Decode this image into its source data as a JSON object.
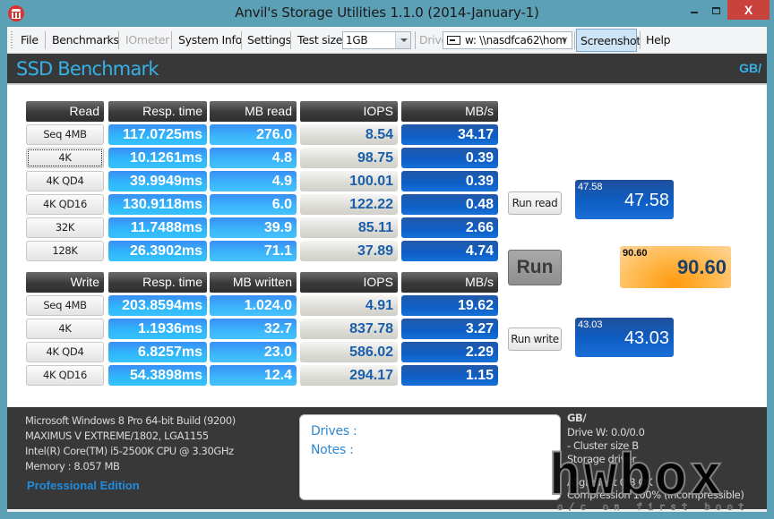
{
  "window": {
    "title": "Anvil's Storage Utilities 1.1.0 (2014-January-1)",
    "close_glyph": "X"
  },
  "toolbar": {
    "file": "File",
    "benchmarks": "Benchmarks",
    "iometer": "IOmeter",
    "system_info": "System Info",
    "settings": "Settings",
    "test_size_label": "Test size",
    "test_size_value": "1GB",
    "drive_label": "Drive",
    "drive_value": "w: \\\\nasdfca62\\hom",
    "drive_chevron": "∨",
    "screenshot": "Screenshot",
    "help": "Help"
  },
  "header": {
    "title": "SSD Benchmark",
    "unit_tag": "GB/"
  },
  "read_table": {
    "headers": [
      "Read",
      "Resp. time",
      "MB read",
      "IOPS",
      "MB/s"
    ],
    "rows": [
      {
        "test": "Seq 4MB",
        "resp": "117.0725ms",
        "mb": "276.0",
        "iops": "8.54",
        "mbs": "34.17"
      },
      {
        "test": "4K",
        "resp": "10.1261ms",
        "mb": "4.8",
        "iops": "98.75",
        "mbs": "0.39"
      },
      {
        "test": "4K QD4",
        "resp": "39.9949ms",
        "mb": "4.9",
        "iops": "100.01",
        "mbs": "0.39"
      },
      {
        "test": "4K QD16",
        "resp": "130.9118ms",
        "mb": "6.0",
        "iops": "122.22",
        "mbs": "0.48"
      },
      {
        "test": "32K",
        "resp": "11.7488ms",
        "mb": "39.9",
        "iops": "85.11",
        "mbs": "2.66"
      },
      {
        "test": "128K",
        "resp": "26.3902ms",
        "mb": "71.1",
        "iops": "37.89",
        "mbs": "4.74"
      }
    ]
  },
  "write_table": {
    "headers": [
      "Write",
      "Resp. time",
      "MB written",
      "IOPS",
      "MB/s"
    ],
    "rows": [
      {
        "test": "Seq 4MB",
        "resp": "203.8594ms",
        "mb": "1.024.0",
        "iops": "4.91",
        "mbs": "19.62"
      },
      {
        "test": "4K",
        "resp": "1.1936ms",
        "mb": "32.7",
        "iops": "837.78",
        "mbs": "3.27"
      },
      {
        "test": "4K QD4",
        "resp": "6.8257ms",
        "mb": "23.0",
        "iops": "586.02",
        "mbs": "2.29"
      },
      {
        "test": "4K QD16",
        "resp": "54.3898ms",
        "mb": "12.4",
        "iops": "294.17",
        "mbs": "1.15"
      }
    ]
  },
  "controls": {
    "run_read": "Run read",
    "run": "Run",
    "run_write": "Run write"
  },
  "scores": {
    "read_small": "47.58",
    "read_big": "47.58",
    "total_small": "90.60",
    "total_big": "90.60",
    "write_small": "43.03",
    "write_big": "43.03"
  },
  "system": {
    "os": "Microsoft Windows 8 Pro 64-bit Build (9200)",
    "board": "MAXIMUS V EXTREME/1802, LGA1155",
    "cpu": "Intel(R) Core(TM) i5-2500K CPU @ 3.30GHz",
    "memory": "Memory : 8.057 MB",
    "edition": "Professional Edition"
  },
  "notes": {
    "drives": "Drives :",
    "notes": "Notes :"
  },
  "drive_info": {
    "unit": "GB/",
    "drive_w": "Drive W: 0.0/0.0",
    "cluster": " - Cluster size B",
    "storage_driver": "Storage driver",
    "alignment": "Alignment 0 B OK",
    "compression": "Compression 100% (Incompressible)"
  },
  "watermark": {
    "brand": "hwbox",
    "tagline": "o/c on first boot"
  }
}
